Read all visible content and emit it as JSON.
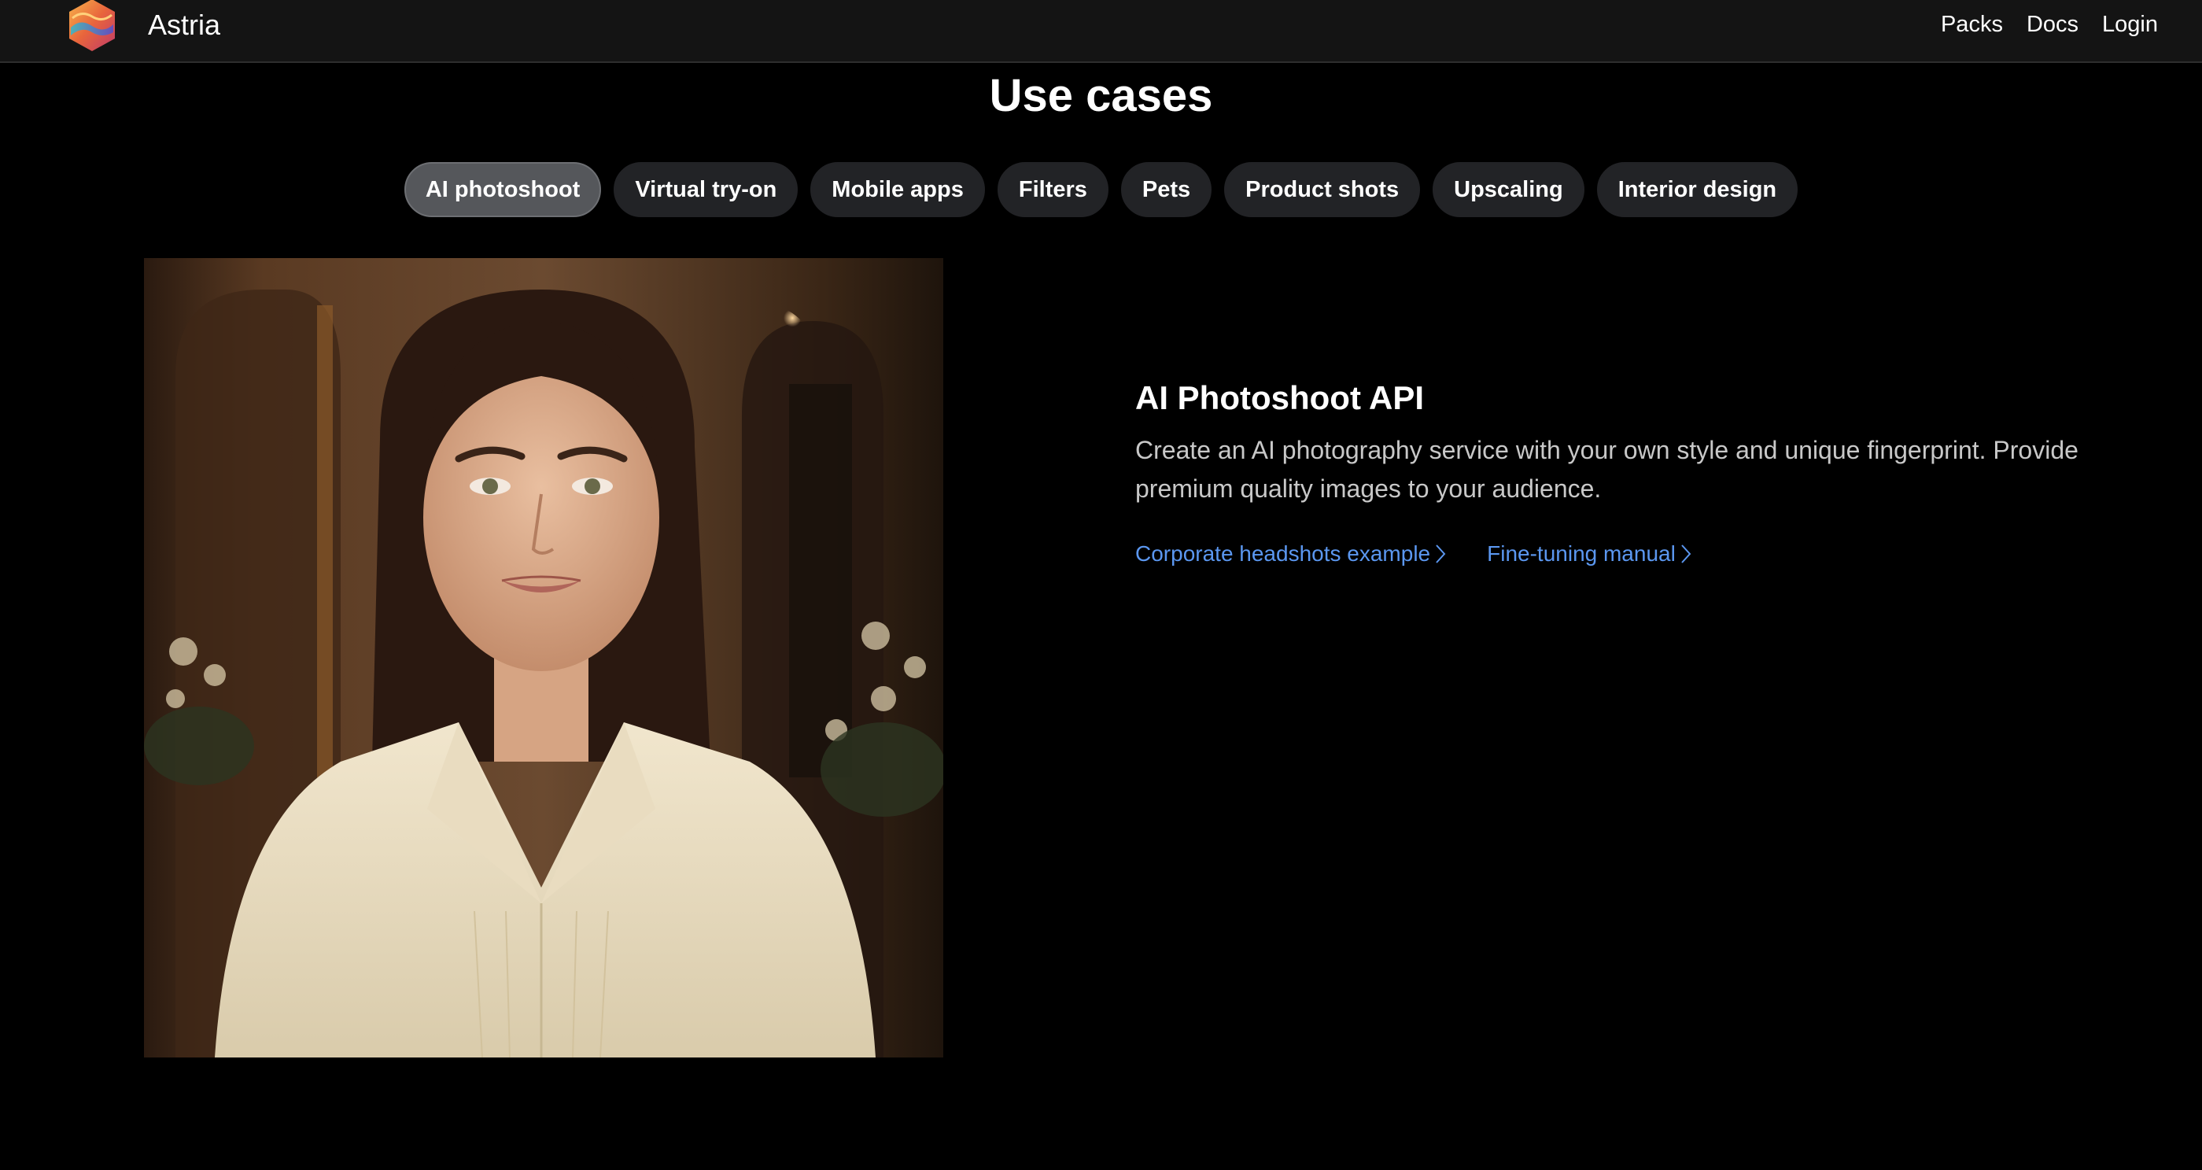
{
  "brand": {
    "name": "Astria",
    "logo_icon": "astria-logo-icon"
  },
  "nav": {
    "links": [
      "Packs",
      "Docs",
      "Login"
    ]
  },
  "section": {
    "title": "Use cases"
  },
  "tabs": [
    {
      "label": "AI photoshoot",
      "active": true
    },
    {
      "label": "Virtual try-on",
      "active": false
    },
    {
      "label": "Mobile apps",
      "active": false
    },
    {
      "label": "Filters",
      "active": false
    },
    {
      "label": "Pets",
      "active": false
    },
    {
      "label": "Product shots",
      "active": false
    },
    {
      "label": "Upscaling",
      "active": false
    },
    {
      "label": "Interior design",
      "active": false
    }
  ],
  "feature": {
    "title": "AI Photoshoot API",
    "description": "Create an AI photography service with your own style and unique fingerprint. Provide premium quality images to your audience.",
    "links": [
      {
        "label": "Corporate headshots example",
        "icon": "chevron-right-icon"
      },
      {
        "label": "Fine-tuning manual",
        "icon": "chevron-right-icon"
      }
    ]
  },
  "colors": {
    "background": "#000000",
    "navbar": "#141414",
    "tab": "#222326",
    "tab_active": "#55575b",
    "link": "#5b97f0",
    "description": "#c8c8c8"
  }
}
